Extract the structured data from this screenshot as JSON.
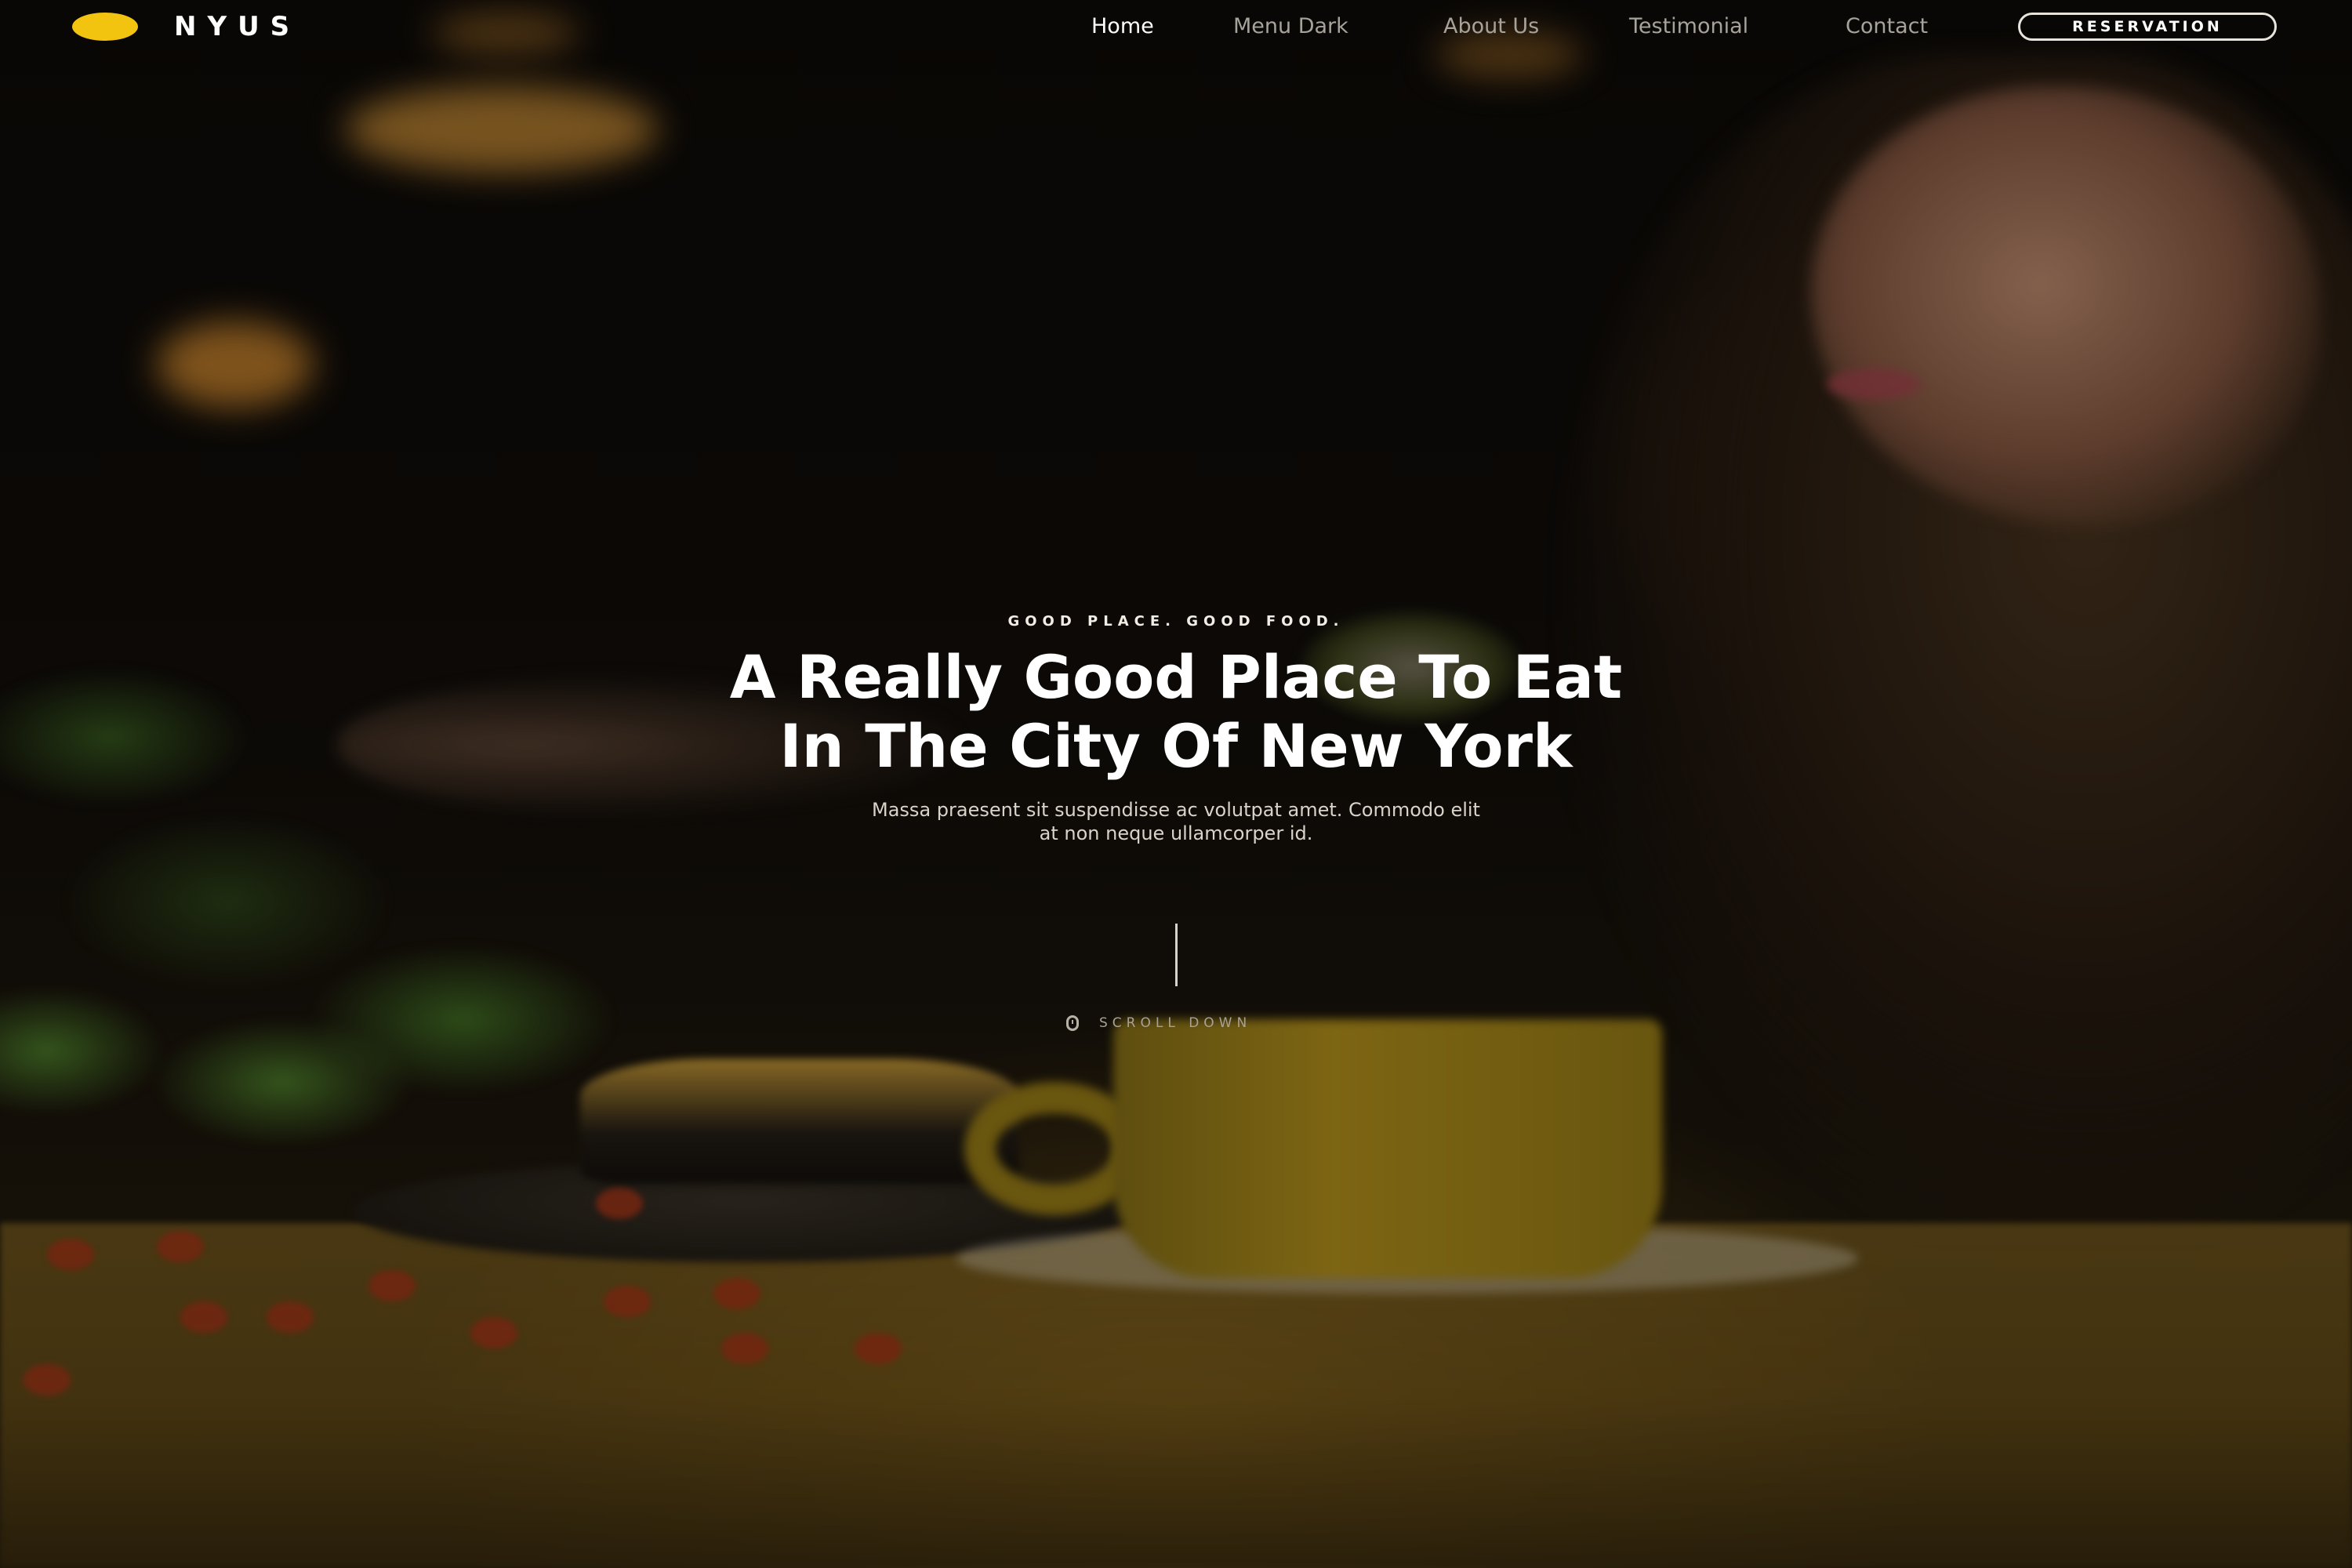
{
  "brand": {
    "name": "NYUS",
    "logo_color": "#f2c40f"
  },
  "nav": {
    "items": [
      {
        "label": "Home",
        "active": true
      },
      {
        "label": "Menu Dark",
        "active": false
      },
      {
        "label": "About Us",
        "active": false
      },
      {
        "label": "Testimonial",
        "active": false
      },
      {
        "label": "Contact",
        "active": false
      }
    ],
    "cta_label": "RESERVATION"
  },
  "hero": {
    "eyebrow": "GOOD PLACE. GOOD FOOD.",
    "title_line1": "A Really Good Place To Eat",
    "title_line2": "In The City Of New York",
    "subtitle_line1": "Massa praesent sit suspendisse ac volutpat amet. Commodo elit",
    "subtitle_line2": "at non neque ullamcorper id.",
    "scroll_label": "SCROLL DOWN",
    "scroll_icon": "mouse-icon"
  },
  "colors": {
    "accent": "#f2c40f",
    "text": "#ffffff",
    "nav_muted": "#a7a29a"
  }
}
